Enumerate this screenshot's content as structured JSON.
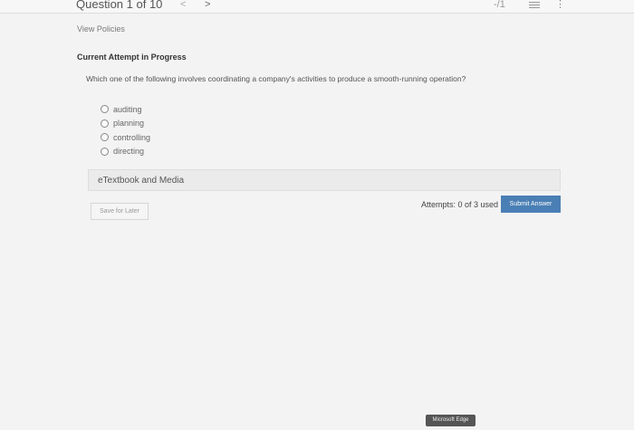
{
  "header": {
    "question_label": "Question 1 of 10",
    "prev_glyph": "<",
    "next_glyph": ">",
    "score": "-/1",
    "more_glyph": "⋮"
  },
  "links": {
    "view_policies": "View Policies"
  },
  "attempt_status": "Current Attempt in Progress",
  "question": {
    "text": "Which one of the following involves coordinating a company's activities to produce a smooth-running operation?",
    "options": [
      "auditing",
      "planning",
      "controlling",
      "directing"
    ]
  },
  "etextbook": {
    "label": "eTextbook and Media"
  },
  "footer": {
    "save_label": "Save for Later",
    "attempts": "Attempts: 0 of 3 used",
    "submit_label": "Submit Answer"
  },
  "taskbar_tooltip": "Microsoft Edge",
  "colors": {
    "accent": "#4a7fb5",
    "background": "#f3f3f3"
  }
}
